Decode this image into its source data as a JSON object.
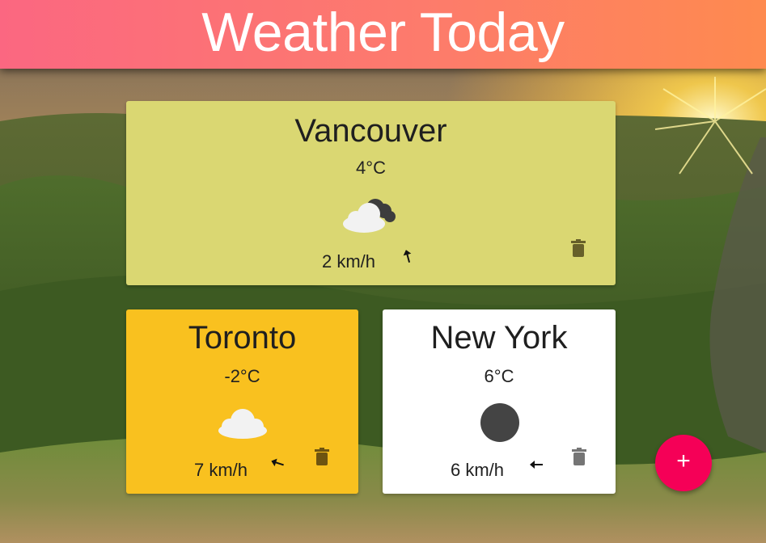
{
  "header": {
    "title": "Weather Today"
  },
  "cards": [
    {
      "city": "Vancouver",
      "temp": "4°C",
      "wind": "2 km/h",
      "condition": "cloudy-dark-cloud-icon",
      "wind_direction_deg": 15
    },
    {
      "city": "Toronto",
      "temp": "-2°C",
      "wind": "7 km/h",
      "condition": "cloud-icon",
      "wind_direction_deg": 290
    },
    {
      "city": "New York",
      "temp": "6°C",
      "wind": "6 km/h",
      "condition": "overcast-circle-icon",
      "wind_direction_deg": 270
    }
  ],
  "fab": {
    "label": "+"
  },
  "colors": {
    "header_start": "#fb6781",
    "header_end": "#fe8a4f",
    "vancouver_card": "#dad772",
    "toronto_card": "#f9c11f",
    "newyork_card": "#ffffff",
    "fab": "#f50057"
  }
}
